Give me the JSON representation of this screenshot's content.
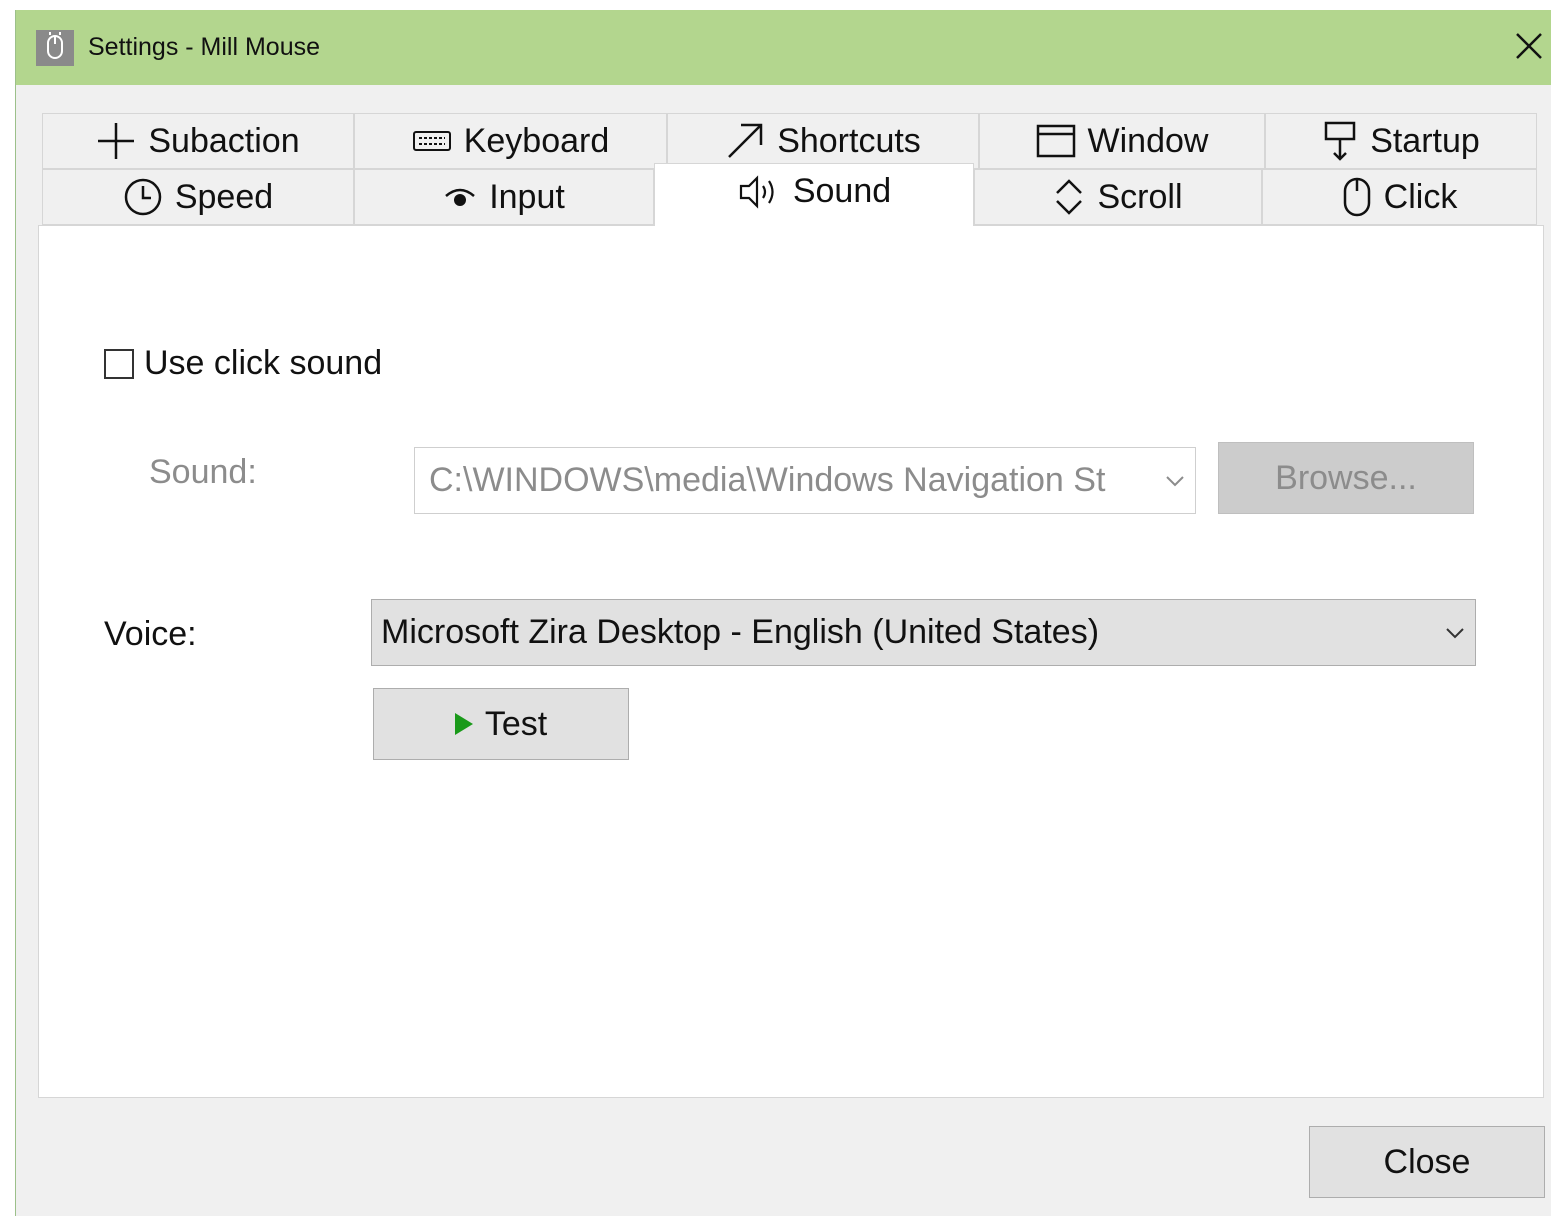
{
  "window": {
    "title": "Settings - Mill Mouse"
  },
  "tabs": {
    "row1": [
      {
        "label": "Subaction",
        "icon": "plus-icon"
      },
      {
        "label": "Keyboard",
        "icon": "keyboard-icon"
      },
      {
        "label": "Shortcuts",
        "icon": "arrow-up-right-icon"
      },
      {
        "label": "Window",
        "icon": "window-icon"
      },
      {
        "label": "Startup",
        "icon": "startup-icon"
      }
    ],
    "row2": [
      {
        "label": "Speed",
        "icon": "clock-icon"
      },
      {
        "label": "Input",
        "icon": "eye-icon"
      },
      {
        "label": "Sound",
        "icon": "speaker-icon"
      },
      {
        "label": "Scroll",
        "icon": "scroll-arrows-icon"
      },
      {
        "label": "Click",
        "icon": "mouse-icon"
      }
    ],
    "active": "Sound"
  },
  "sound_panel": {
    "use_click_sound_label": "Use click sound",
    "use_click_sound_checked": false,
    "sound_label": "Sound:",
    "sound_value": "C:\\WINDOWS\\media\\Windows Navigation St",
    "browse_label": "Browse...",
    "voice_label": "Voice:",
    "voice_value": "Microsoft Zira Desktop - English (United States)",
    "test_label": "Test"
  },
  "footer": {
    "close_label": "Close"
  },
  "colors": {
    "titlebar": "#b3d68e",
    "window_bg": "#f0f0f0",
    "panel_bg": "#ffffff",
    "play_icon": "#1a9a1a"
  }
}
